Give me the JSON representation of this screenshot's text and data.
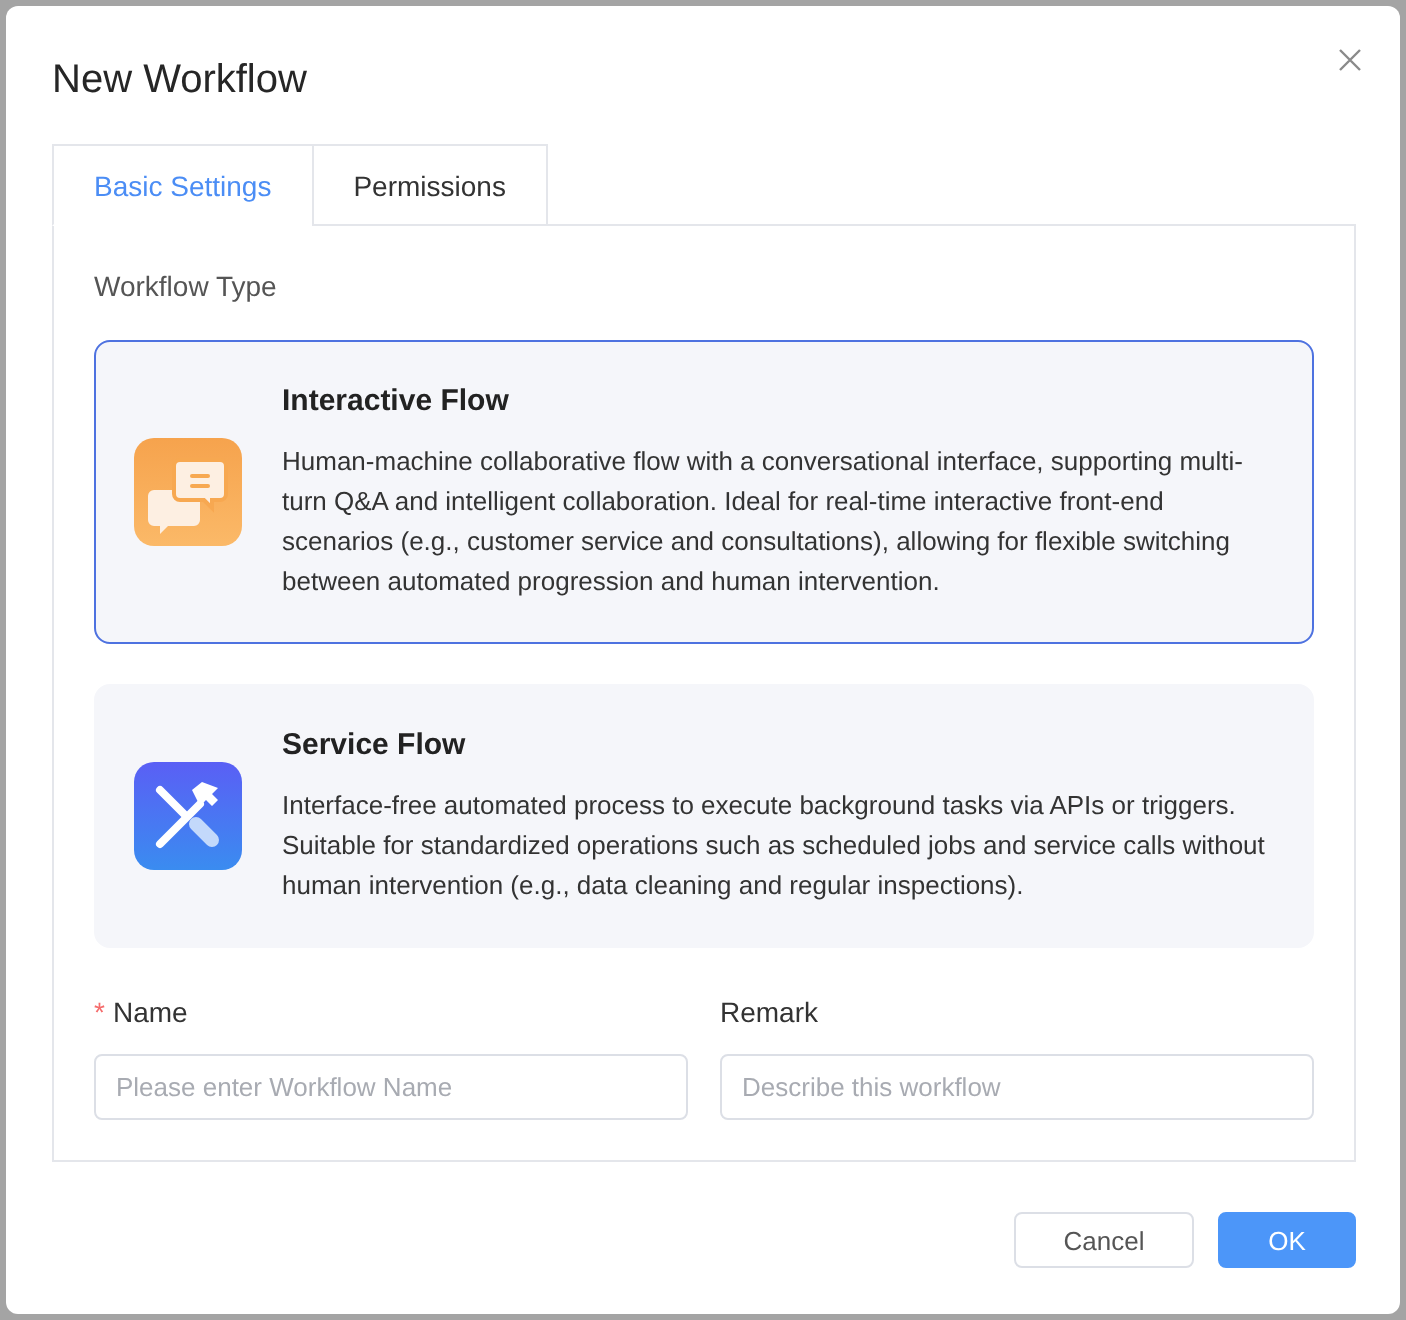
{
  "dialog": {
    "title": "New Workflow"
  },
  "tabs": [
    {
      "label": "Basic Settings",
      "selected": true
    },
    {
      "label": "Permissions",
      "selected": false
    }
  ],
  "workflow_type": {
    "label": "Workflow Type",
    "options": [
      {
        "kind": "interactive",
        "title": "Interactive Flow",
        "description": "Human-machine collaborative flow with a conversational interface, supporting multi-turn Q&A and intelligent collaboration. Ideal for real-time interactive front-end scenarios (e.g., customer service and consultations), allowing for flexible switching between automated progression and human intervention.",
        "selected": true
      },
      {
        "kind": "service",
        "title": "Service Flow",
        "description": "Interface-free automated process to execute background tasks via APIs or triggers. Suitable for standardized operations such as scheduled jobs and service calls without human intervention (e.g., data cleaning and regular inspections).",
        "selected": false
      }
    ]
  },
  "fields": [
    {
      "required_mark": "*",
      "label": "Name",
      "placeholder": "Please enter Workflow Name"
    },
    {
      "label": "Remark",
      "placeholder": "Describe this workflow"
    }
  ],
  "buttons": [
    {
      "kind": "cancel",
      "label": "Cancel"
    },
    {
      "kind": "confirm",
      "label": "OK"
    }
  ]
}
